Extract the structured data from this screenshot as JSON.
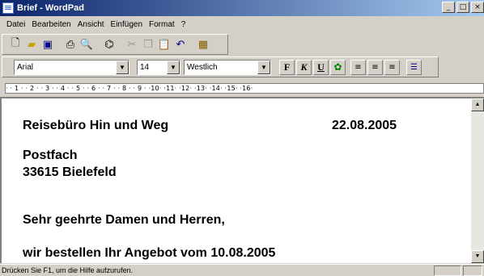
{
  "window": {
    "title": "Brief - WordPad",
    "min_label": "_",
    "max_label": "□",
    "close_label": "×"
  },
  "menu": {
    "items": [
      "Datei",
      "Bearbeiten",
      "Ansicht",
      "Einfügen",
      "Format",
      "?"
    ]
  },
  "format_bar": {
    "font": "Arial",
    "size": "14",
    "script": "Westlich",
    "bold_label": "F",
    "italic_label": "K",
    "underline_label": "U"
  },
  "ruler": {
    "text": "·  ·  1  ·  ·  2  ·  ·  3  ·  ·  4  ·  ·  5  ·  ·  6  ·  ·  7  ·  ·  8  ·  ·  9  ·  ·10·  ·11·  ·12·  ·13·  ·14·  ·15·  ·16·"
  },
  "document": {
    "sender_line": "Reisebüro Hin und Weg",
    "date": "22.08.2005",
    "address_1": "Postfach",
    "address_2": "33615 Bielefeld",
    "greeting": "Sehr geehrte Damen und Herren,",
    "body_1": "wir bestellen Ihr Angebot vom 10.08.2005"
  },
  "status": {
    "hint": "Drücken Sie F1, um die Hilfe aufzurufen."
  },
  "icons": {
    "new": "new-document-icon",
    "open": "open-folder-icon",
    "save": "save-disk-icon",
    "print": "print-icon",
    "preview": "print-preview-icon",
    "find": "find-binoculars-icon",
    "cut": "cut-icon",
    "copy": "copy-icon",
    "paste": "paste-icon",
    "undo": "undo-icon",
    "datetime": "insert-datetime-icon",
    "color": "color-icon",
    "align_left": "align-left-icon",
    "align_center": "align-center-icon",
    "align_right": "align-right-icon",
    "bullets": "bullets-icon"
  }
}
